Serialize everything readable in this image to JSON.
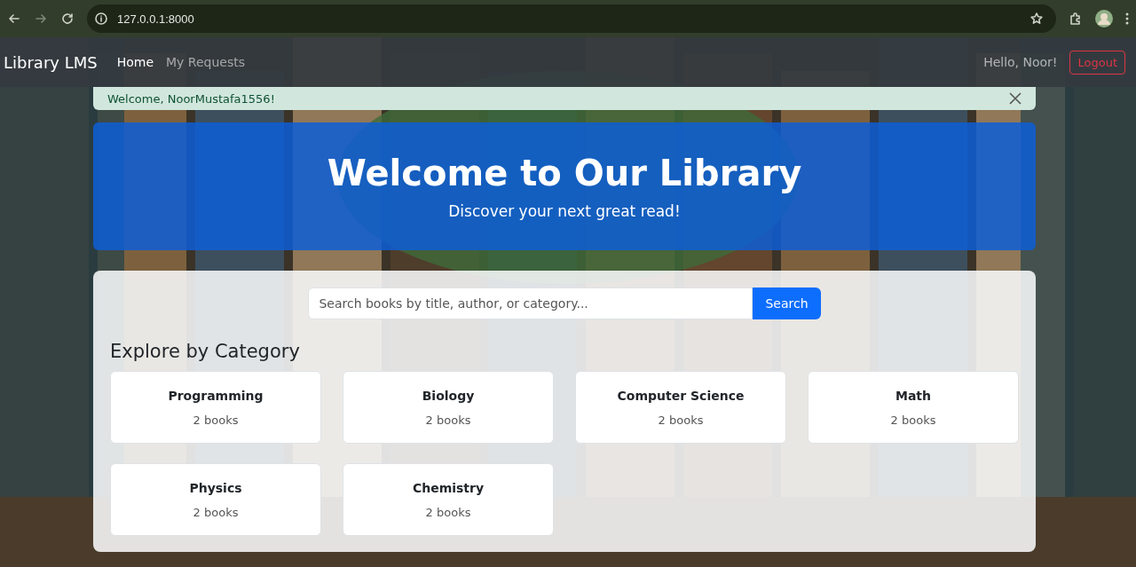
{
  "browser": {
    "url": "127.0.0.1:8000"
  },
  "navbar": {
    "brand": "Library LMS",
    "links": [
      {
        "label": "Home",
        "selected": true
      },
      {
        "label": "My Requests",
        "selected": false
      }
    ],
    "greeting": "Hello, Noor!",
    "logout": "Logout"
  },
  "alert": {
    "text": "Welcome, NoorMustafa1556!"
  },
  "hero": {
    "title": "Welcome to Our Library",
    "subtitle": "Discover your next great read!"
  },
  "search": {
    "placeholder": "Search books by title, author, or category...",
    "button": "Search"
  },
  "categories_heading": "Explore by Category",
  "categories": [
    {
      "name": "Programming",
      "count": "2 books"
    },
    {
      "name": "Biology",
      "count": "2 books"
    },
    {
      "name": "Computer Science",
      "count": "2 books"
    },
    {
      "name": "Math",
      "count": "2 books"
    },
    {
      "name": "Physics",
      "count": "2 books"
    },
    {
      "name": "Chemistry",
      "count": "2 books"
    }
  ]
}
